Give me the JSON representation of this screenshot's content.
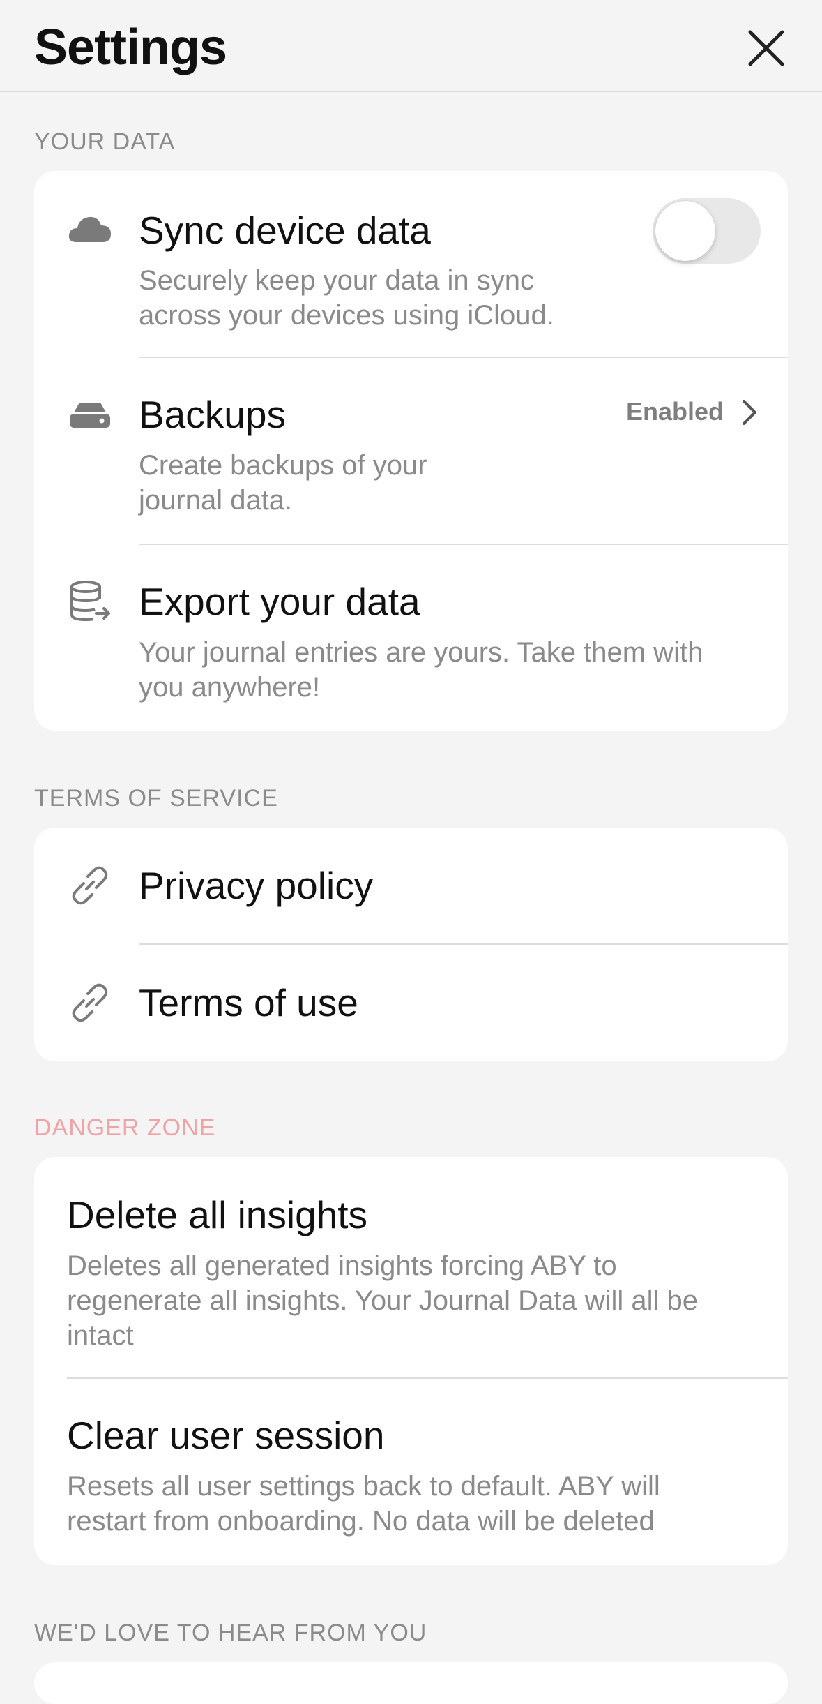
{
  "header": {
    "title": "Settings"
  },
  "sections": {
    "your_data": {
      "label": "YOUR DATA",
      "sync": {
        "title": "Sync device data",
        "desc_line1": "Securely keep your data in sync",
        "desc_line2": "across your devices using iCloud.",
        "toggle_on": false
      },
      "backups": {
        "title": "Backups",
        "desc_line1": "Create backups of your",
        "desc_line2": "journal data.",
        "status": "Enabled"
      },
      "export": {
        "title": "Export your data",
        "desc_line1": "Your journal entries are yours. Take them with",
        "desc_line2": "you anywhere!"
      }
    },
    "terms": {
      "label": "TERMS OF SERVICE",
      "privacy": {
        "title": "Privacy policy"
      },
      "terms_of_use": {
        "title": "Terms of use"
      }
    },
    "danger": {
      "label": "DANGER ZONE",
      "delete_insights": {
        "title": "Delete all insights",
        "desc_line1": "Deletes all generated insights forcing ABY to",
        "desc_line2": "regenerate all insights. Your Journal Data will all be",
        "desc_line3": "intact"
      },
      "clear_session": {
        "title": "Clear user session",
        "desc_line1": "Resets all user settings back to default. ABY will",
        "desc_line2": "restart from onboarding. No data will be deleted"
      }
    },
    "feedback": {
      "label": "WE'D LOVE TO HEAR FROM YOU"
    }
  },
  "colors": {
    "background": "#f4f4f4",
    "card": "#ffffff",
    "danger_label": "#f0a3a6",
    "muted": "#8a8a8a"
  },
  "icons": [
    "close-icon",
    "cloud-icon",
    "backup-drive-icon",
    "database-export-icon",
    "link-icon",
    "chevron-right-icon"
  ]
}
